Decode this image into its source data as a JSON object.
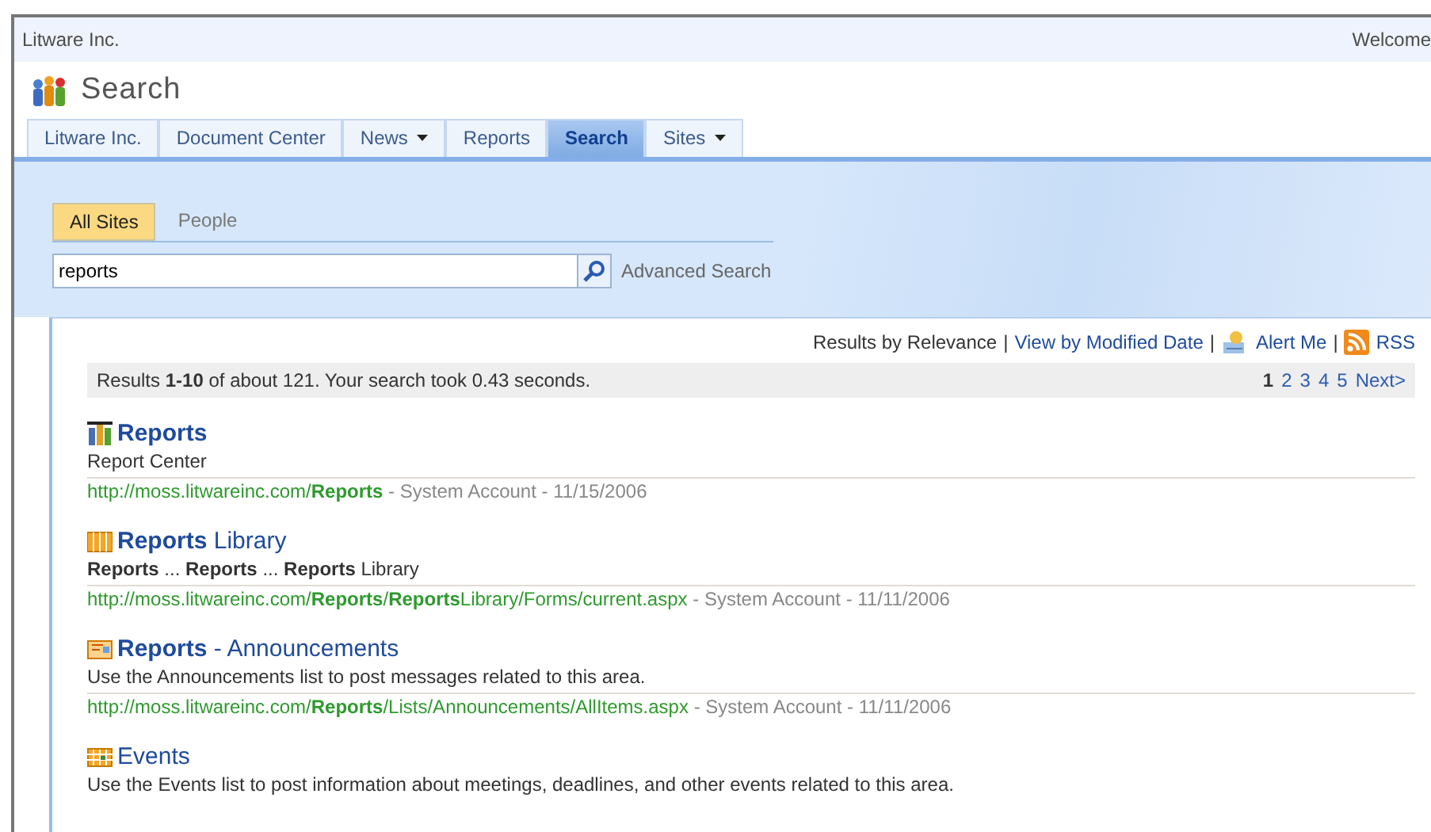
{
  "top_bar": {
    "site": "Litware Inc.",
    "welcome": "Welcome"
  },
  "page_title": "Search",
  "nav_tabs": [
    {
      "label": "Litware Inc.",
      "selected": false,
      "has_menu": false
    },
    {
      "label": "Document Center",
      "selected": false,
      "has_menu": false
    },
    {
      "label": "News",
      "selected": false,
      "has_menu": true
    },
    {
      "label": "Reports",
      "selected": false,
      "has_menu": false
    },
    {
      "label": "Search",
      "selected": true,
      "has_menu": false
    },
    {
      "label": "Sites",
      "selected": false,
      "has_menu": true
    }
  ],
  "scopes": [
    {
      "label": "All Sites",
      "selected": true
    },
    {
      "label": "People",
      "selected": false
    }
  ],
  "search": {
    "value": "reports",
    "advanced": "Advanced Search"
  },
  "sort_bar": {
    "relevance": "Results by Relevance",
    "separator_1": "|",
    "modified": "View by Modified Date",
    "separator_2": "|",
    "alert": "Alert Me",
    "separator_3": "|",
    "rss": "RSS"
  },
  "summary": "Results **1-10** of about 121. Your search took 0.43 seconds.",
  "pager": [
    {
      "label": "1",
      "selected": true
    },
    {
      "label": "2",
      "selected": false
    },
    {
      "label": "3",
      "selected": false
    },
    {
      "label": "4",
      "selected": false
    },
    {
      "label": "5",
      "selected": false
    },
    {
      "label": "Next>",
      "selected": false
    }
  ],
  "results": [
    {
      "kind": "center",
      "title": "**Reports**",
      "description": "Report Center",
      "url": "http://moss.litwareinc.com/**Reports**",
      "meta": " - System Account - 11/15/2006"
    },
    {
      "kind": "library",
      "title": "**Reports** Library",
      "description": "**Reports** ... **Reports** ... **Reports** Library",
      "url": "http://moss.litwareinc.com/**Reports**/**Reports**Library/Forms/current.aspx",
      "meta": " - System Account - 11/11/2006"
    },
    {
      "kind": "announcements",
      "title": "**Reports** - Announcements",
      "description": "Use the Announcements list to post messages related to this area.",
      "url": "http://moss.litwareinc.com/**Reports**/Lists/Announcements/AllItems.aspx",
      "meta": " - System Account - 11/11/2006"
    },
    {
      "kind": "events",
      "title": "Events",
      "description": "Use the Events list to post information about meetings, deadlines, and other events related to this area."
    }
  ]
}
